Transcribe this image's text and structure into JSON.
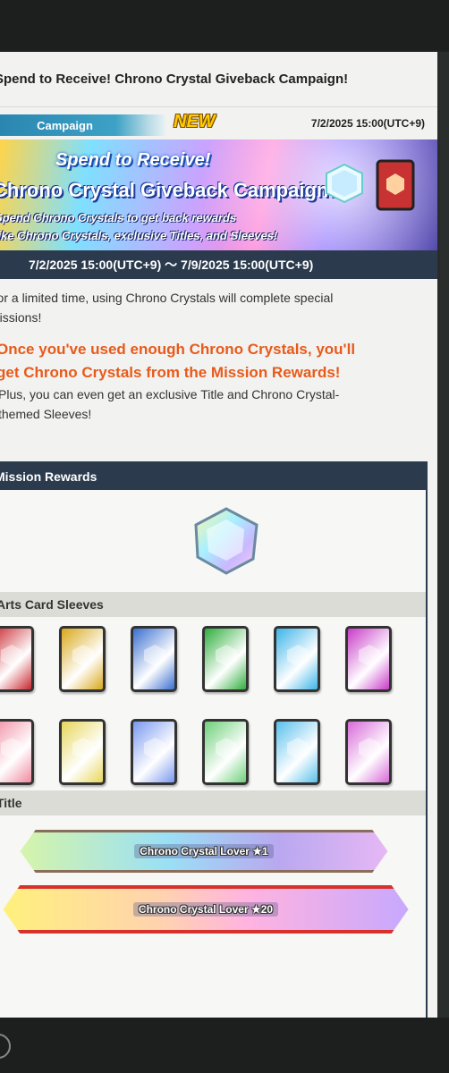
{
  "notice": {
    "title": "Spend to Receive! Chrono Crystal Giveback Campaign!",
    "category": "Campaign",
    "badge": "NEW",
    "posted": "7/2/2025 15:00(UTC+9)"
  },
  "banner": {
    "line1": "Spend to Receive!",
    "line2": "Chrono Crystal Giveback Campaign!",
    "line3": "Spend Chrono Crystals to get back rewards",
    "line4": "like Chrono Crystals, exclusive Titles, and Sleeves!"
  },
  "period": "7/2/2025 15:00(UTC+9) ～ 7/9/2025 15:00(UTC+9)",
  "description": {
    "line1": "For a limited time, using Chrono Crystals will complete special",
    "line2": "missions!",
    "highlight1": "Once you've used enough Chrono Crystals, you'll",
    "highlight2": "get Chrono Crystals from the Mission Rewards!",
    "line3": "Plus, you can even get an exclusive Title and Chrono Crystal-",
    "line4": "themed Sleeves!"
  },
  "rewards": {
    "header": "Mission Rewards",
    "sleeves_header": "Arts Card Sleeves",
    "title_header": "Title",
    "titles": [
      "Chrono Crystal Lover ★1",
      "Chrono Crystal Lover ★20"
    ]
  },
  "colors": {
    "sleeves_row1": [
      "#c8262e",
      "#d8a81a",
      "#3a6fd0",
      "#2fae3d",
      "#3cb4e8",
      "#c83cc8"
    ],
    "sleeves_row2": [
      "#f08aa0",
      "#e8d65a",
      "#7a98f0",
      "#6ed07a",
      "#5ac0ec",
      "#d86ad8"
    ]
  }
}
